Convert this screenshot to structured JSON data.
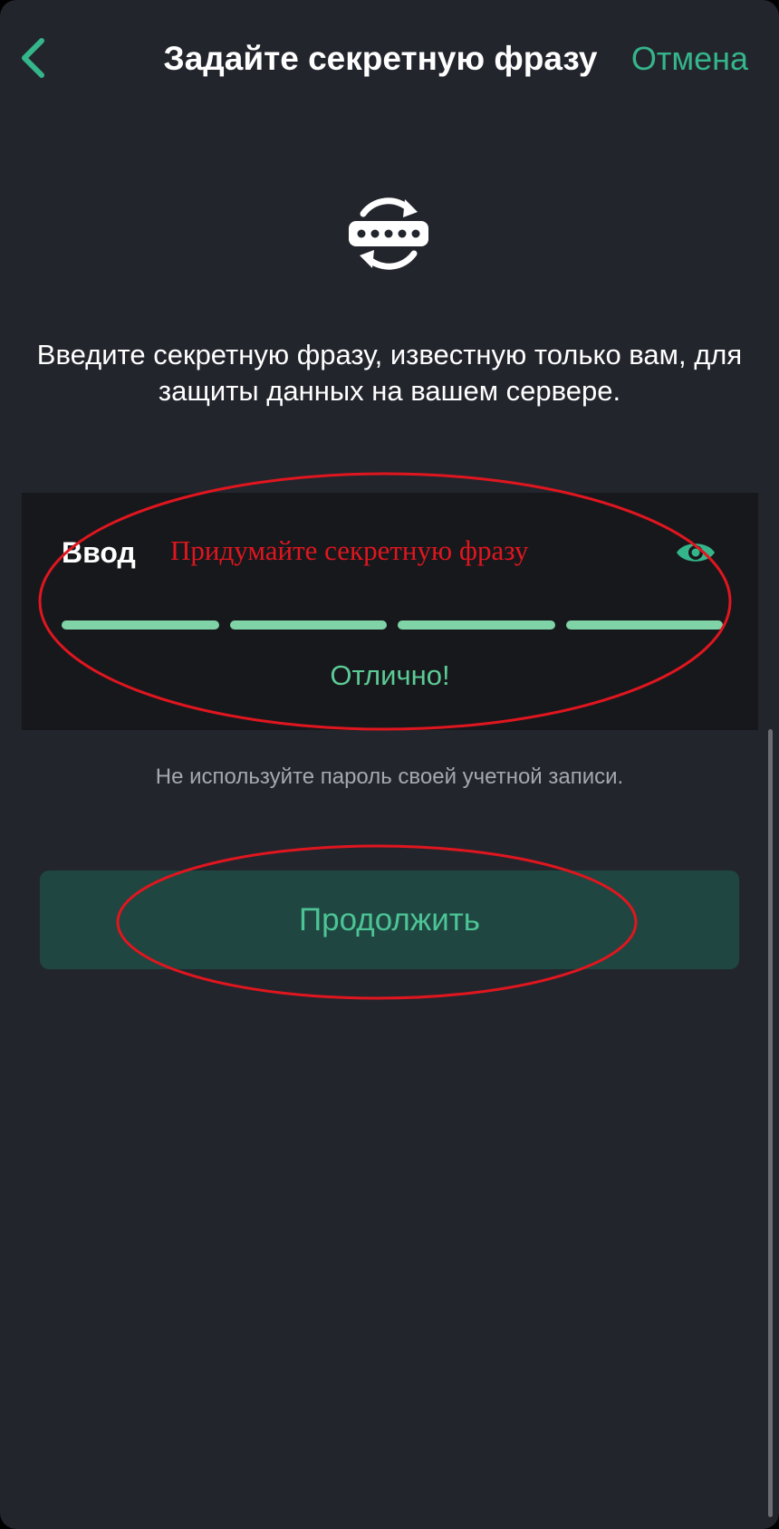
{
  "header": {
    "title": "Задайте секретную фразу",
    "cancel_label": "Отмена",
    "back_icon": "chevron-left-icon"
  },
  "hero": {
    "icon": "password-refresh-icon",
    "description": "Введите секретную фразу, известную только вам, для защиты данных на вашем сервере."
  },
  "input_card": {
    "label": "Ввод",
    "value": "Придумайте секретную фразу",
    "visibility_icon": "eye-icon",
    "strength": {
      "filled_segments": 4,
      "total_segments": 4,
      "text": "Отлично!"
    }
  },
  "hint": "Не используйте пароль своей учетной записи.",
  "continue_label": "Продолжить",
  "colors": {
    "background": "#23252d",
    "card": "#17181c",
    "accent": "#35b58a",
    "strength": "#7fd3a7",
    "button_bg": "#1f4640",
    "annotation": "#e0161f"
  }
}
